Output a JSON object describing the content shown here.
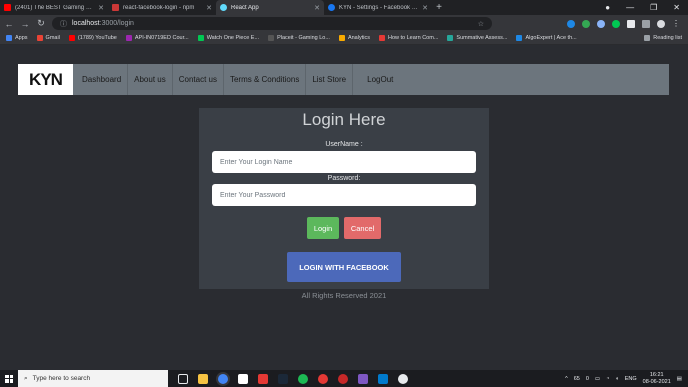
{
  "browser": {
    "tabs": [
      {
        "title": "(2401) The BEST Gaming Mouse",
        "color": "#ff0000",
        "active": false
      },
      {
        "title": "react-facebook-login - npm",
        "color": "#cb3837",
        "active": false
      },
      {
        "title": "React App",
        "color": "#61dafb",
        "active": true
      },
      {
        "title": "KYN - Settings - Facebook for D",
        "color": "#1877f2",
        "active": false
      }
    ],
    "new_tab_label": "+",
    "url_host": "localhost",
    "url_path": ":3000/login",
    "bookmarks": [
      {
        "label": "Apps",
        "color": "#4285f4"
      },
      {
        "label": "Gmail",
        "color": "#ea4335"
      },
      {
        "label": "(1789) YouTube",
        "color": "#ff0000"
      },
      {
        "label": "API-IN0719ED Cour...",
        "color": "#9c27b0"
      },
      {
        "label": "Watch One Piece E...",
        "color": "#00c853"
      },
      {
        "label": "Placeit - Gaming Lo...",
        "color": "#555555"
      },
      {
        "label": "Analytics",
        "color": "#f9ab00"
      },
      {
        "label": "How to Learn Com...",
        "color": "#e53935"
      },
      {
        "label": "Summative Assess...",
        "color": "#26a69a"
      },
      {
        "label": "AlgoExpert | Ace th...",
        "color": "#1e88e5"
      }
    ],
    "reading_list": "Reading list"
  },
  "navbar": {
    "brand": "KYN",
    "links": [
      "Dashboard",
      "About us",
      "Contact us",
      "Terms & Conditions",
      "List Store",
      "LogOut"
    ]
  },
  "login": {
    "title": "Login Here",
    "username_label": "UserName :",
    "username_placeholder": "Enter Your Login Name",
    "password_label": "Password:",
    "password_placeholder": "Enter Your Password",
    "login_button": "Login",
    "cancel_button": "Cancel",
    "facebook_button": "LOGIN WITH FACEBOOK"
  },
  "footer": "All Rights Reserved 2021",
  "taskbar": {
    "search_placeholder": "Type here to search",
    "language": "ENG",
    "time": "16:21",
    "date": "08-06-2021",
    "temperature": "65",
    "battery_percent": "0"
  },
  "colors": {
    "page_bg": "#2a2c31",
    "navbar_bg": "#6c757d",
    "card_bg": "#3a3f46",
    "login_green": "#5cb85c",
    "cancel_red": "#e26a6a",
    "facebook_blue": "#4c69ba"
  }
}
